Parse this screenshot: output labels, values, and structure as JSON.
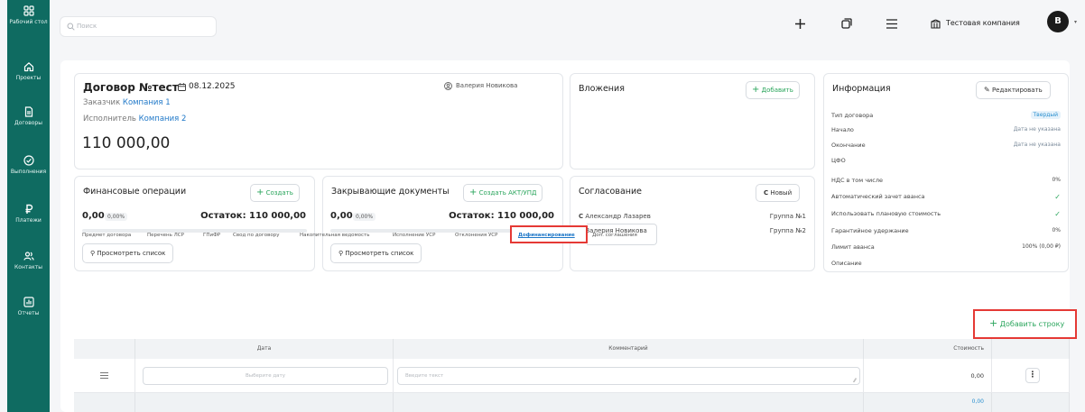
{
  "sidebar": {
    "items": [
      {
        "label": "Рабочий стол",
        "icon": "dashboard-icon"
      },
      {
        "label": "Проекты",
        "icon": "home-icon"
      },
      {
        "label": "Договоры",
        "icon": "document-icon"
      },
      {
        "label": "Выполнения",
        "icon": "check-circle-icon"
      },
      {
        "label": "Платежи",
        "icon": "ruble-icon"
      },
      {
        "label": "Контакты",
        "icon": "users-icon"
      },
      {
        "label": "Отчеты",
        "icon": "chart-icon"
      }
    ]
  },
  "header": {
    "search_placeholder": "Поиск",
    "company": "Тестовая компания",
    "avatar_letter": "В"
  },
  "contract": {
    "title": "Договор №тест",
    "date": "08.12.2025",
    "manager": "Валерия Новикова",
    "customer_label": "Заказчик",
    "customer": "Компания 1",
    "executor_label": "Исполнитель",
    "executor": "Компания 2",
    "amount": "110 000,00"
  },
  "attachments": {
    "title": "Вложения",
    "add": "Добавить"
  },
  "info": {
    "title": "Информация",
    "edit": "Редактировать",
    "rows": [
      {
        "label": "Тип договора",
        "value": "Твердый"
      },
      {
        "label": "Начало",
        "value": "Дата не указана"
      },
      {
        "label": "Окончание",
        "value": "Дата не указана"
      },
      {
        "label": "ЦФО",
        "value": ""
      },
      {
        "label": "НДС в том числе",
        "value": "0%"
      },
      {
        "label": "Автоматический зачет аванса",
        "value": "✓"
      },
      {
        "label": "Использовать плановую стоимость",
        "value": "✓"
      },
      {
        "label": "Гарантийное удержание",
        "value": "0%"
      },
      {
        "label": "Лимит аванса",
        "value": "100% (0,00 ₽)"
      },
      {
        "label": "Описание",
        "value": ""
      }
    ]
  },
  "finance": {
    "title": "Финансовые операции",
    "create": "Создать",
    "value": "0,00",
    "percent": "0,00%",
    "remainder": "Остаток: 110 000,00",
    "view_list": "Просмотреть список",
    "progress": 0
  },
  "closing": {
    "title": "Закрывающие документы",
    "create": "Создать АКТ/УПД",
    "value": "0,00",
    "percent": "0,00%",
    "remainder": "Остаток: 110 000,00",
    "view_list": "Просмотреть список",
    "progress": 0
  },
  "approval": {
    "title": "Согласование",
    "new": "Новый",
    "rows": [
      {
        "name": "Александр Лазарев",
        "group": "Группа №1"
      },
      {
        "name": "Валерия Новикова",
        "group": "Группа №2"
      }
    ]
  },
  "tabs": [
    "Предмет договора",
    "Перечень ЛСР",
    "ГПиФР",
    "Свод по договору",
    "Накопительная ведомость",
    "Исполнение УСР",
    "Отклонения УСР",
    "Дофинансирование",
    "Доп. соглашения"
  ],
  "active_tab": "Дофинансирование",
  "add_row": "Добавить строку",
  "table": {
    "headers": {
      "date": "Дата",
      "comment": "Комментарий",
      "cost": "Стоимость"
    },
    "row": {
      "date_placeholder": "Выберите дату",
      "comment_placeholder": "Введите текст",
      "cost": "0,00"
    },
    "total": "0,00"
  },
  "colors": {
    "sidebar": "#0f6b61",
    "accent_green": "#2aa55c",
    "link_blue": "#1f78c8",
    "highlight_red": "#e53935"
  }
}
